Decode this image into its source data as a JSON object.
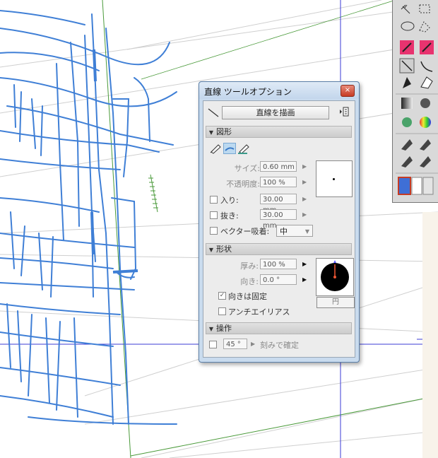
{
  "tool_options": {
    "title": "直線 ツールオプション",
    "close_glyph": "×",
    "draw_button": "直線を描画",
    "section_shape": "図形",
    "size_label": "サイズ:",
    "size_value": "0.60 mm",
    "opacity_label": "不透明度:",
    "opacity_value": "100 %",
    "taper_in_label": "入り:",
    "taper_in_value": "30.00 mm",
    "taper_out_label": "抜き:",
    "taper_out_value": "30.00 mm",
    "vector_snap_label": "ベクター吸着:",
    "vector_snap_value": "中",
    "section_form": "形状",
    "thickness_label": "厚み:",
    "thickness_value": "100 %",
    "direction_label": "向き:",
    "direction_value": "0.0 °",
    "fixed_direction_label": "向きは固定",
    "antialias_label": "アンチエイリアス",
    "circle_label": "円",
    "section_operation": "操作",
    "angle_value": "45 °",
    "angle_step_label": "刻みで確定"
  },
  "icons": {
    "line_tool": "line-tool-icon",
    "menu": "panel-menu-icon",
    "shape_pen": "pen-shape-icon",
    "shape_brush": "brush-shape-icon",
    "shape_marker": "marker-shape-icon"
  },
  "colors": {
    "sketch_stroke": "#3f7fd6",
    "guide_green": "#4a9a3a",
    "guide_blue": "#3b3bd6",
    "window_frame": "#c9dbee",
    "accent_red": "#c63b24",
    "palette_pink": "#e8336f"
  }
}
